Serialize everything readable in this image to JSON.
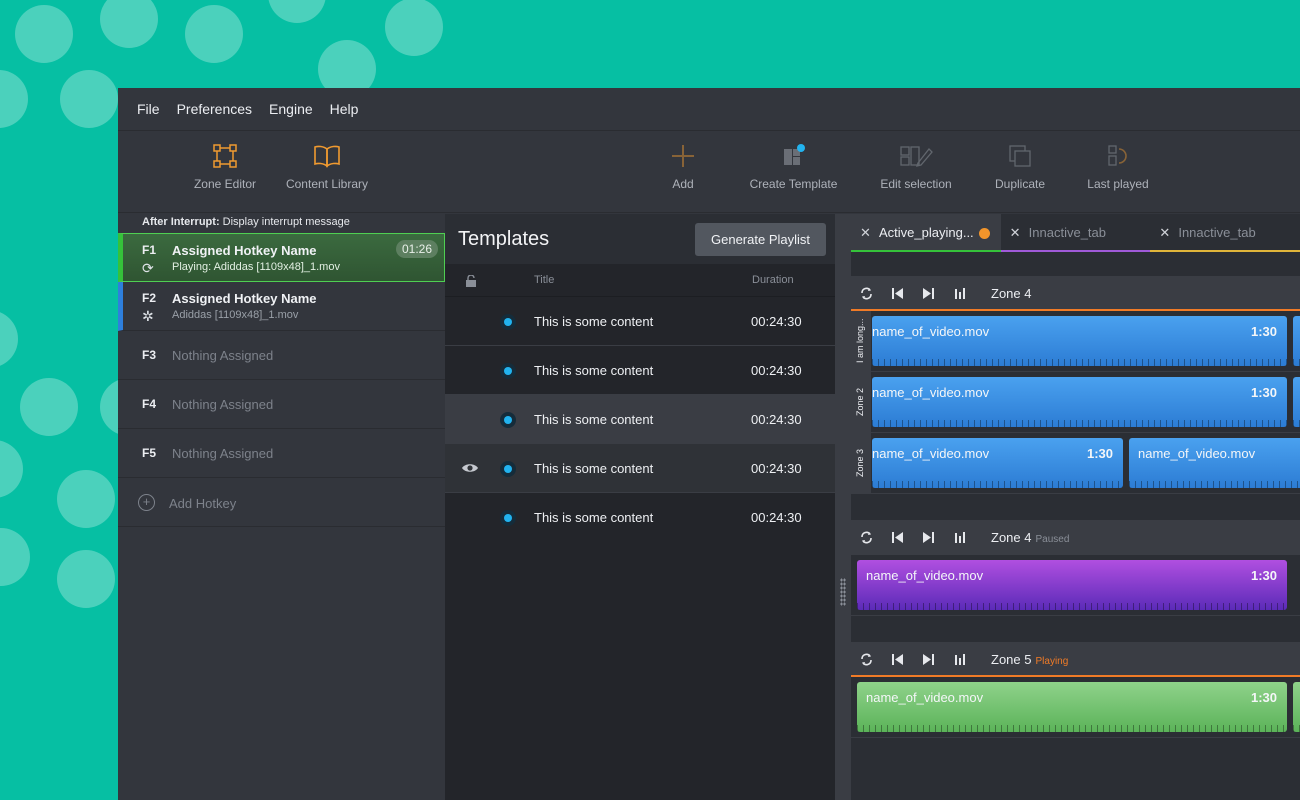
{
  "menu": [
    "File",
    "Preferences",
    "Engine",
    "Help"
  ],
  "toolbar": {
    "zone_editor": "Zone Editor",
    "content_library": "Content Library",
    "add": "Add",
    "create_template": "Create Template",
    "edit_selection": "Edit selection",
    "duplicate": "Duplicate",
    "last_played": "Last played"
  },
  "colors": {
    "accent": "#f09a30",
    "teal_bg": "#06bfa3",
    "playing": "#35c23a",
    "hotkey_f2": "#2e7fdc"
  },
  "hotkeys": {
    "interrupt_label": "After Interrupt:",
    "interrupt_value": "Display interrupt message",
    "items": [
      {
        "key": "F1",
        "name": "Assigned Hotkey Name",
        "sub": "Playing: Adiddas [1109x48]_1.mov",
        "badge": "01:26",
        "icon": "loop-icon"
      },
      {
        "key": "F2",
        "name": "Assigned Hotkey Name",
        "sub": "Adiddas [1109x48]_1.mov",
        "icon": "loading-icon"
      },
      {
        "key": "F3",
        "name": "Nothing Assigned"
      },
      {
        "key": "F4",
        "name": "Nothing Assigned"
      },
      {
        "key": "F5",
        "name": "Nothing Assigned"
      }
    ],
    "add_label": "Add Hotkey"
  },
  "templates": {
    "title": "Templates",
    "generate_label": "Generate Playlist",
    "col_title": "Title",
    "col_duration": "Duration",
    "rows": [
      {
        "title": "This is some content",
        "duration": "00:24:30"
      },
      {
        "title": "This is some content",
        "duration": "00:24:30"
      },
      {
        "title": "This is some content",
        "duration": "00:24:30"
      },
      {
        "title": "This is some content",
        "duration": "00:24:30"
      },
      {
        "title": "This is some content",
        "duration": "00:24:30"
      }
    ]
  },
  "tabs": [
    {
      "label": "Active_playing...",
      "close": "✕"
    },
    {
      "label": "Innactive_tab",
      "close": "✕"
    },
    {
      "label": "Innactive_tab",
      "close": "✕"
    }
  ],
  "zones": [
    {
      "name": "Zone 4",
      "status": "",
      "lanes": [
        {
          "label": "I am long...",
          "clips": [
            {
              "name": "name_of_video.mov",
              "duration": "1:30"
            }
          ]
        },
        {
          "label": "Zone 2",
          "clips": [
            {
              "name": "name_of_video.mov",
              "duration": "1:30"
            }
          ]
        },
        {
          "label": "Zone 3",
          "clips": [
            {
              "name": "name_of_video.mov",
              "duration": "1:30"
            },
            {
              "name": "name_of_video.mov",
              "duration": ""
            }
          ]
        }
      ]
    },
    {
      "name": "Zone 4",
      "status": "Paused",
      "status_color": "#8a8f98",
      "lanes": [
        {
          "clips": [
            {
              "name": "name_of_video.mov",
              "duration": "1:30"
            }
          ]
        }
      ]
    },
    {
      "name": "Zone 5",
      "status": "Playing",
      "status_color": "#f07b27",
      "lanes": [
        {
          "clips": [
            {
              "name": "name_of_video.mov",
              "duration": "1:30"
            }
          ]
        }
      ]
    }
  ]
}
